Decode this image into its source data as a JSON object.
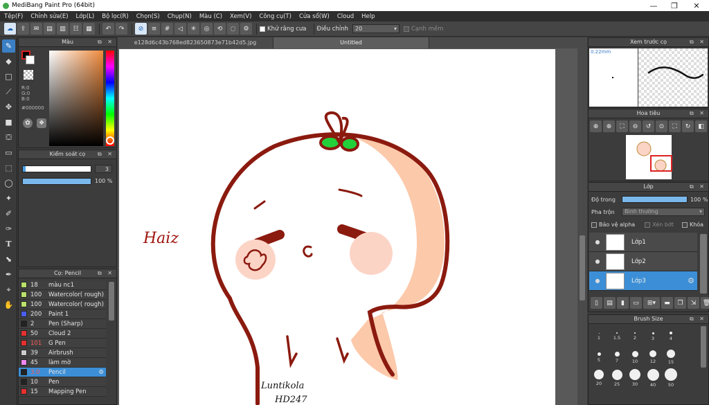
{
  "window": {
    "title": "MediBang Paint Pro (64bit)"
  },
  "menu": [
    "Tệp(F)",
    "Chỉnh sửa(E)",
    "Lớp(L)",
    "Bộ lọc(R)",
    "Chọn(S)",
    "Chụp(N)",
    "Màu (C)",
    "Xem(V)",
    "Công cụ(T)",
    "Cửa sổ(W)",
    "Cloud",
    "Help"
  ],
  "toolbar": {
    "antialias_label": "Khử răng cưa",
    "adjust_label": "Điều chỉnh",
    "adjust_value": "20",
    "snap_label": "Cạnh mềm"
  },
  "color_panel": {
    "title": "Màu",
    "r": "R:0",
    "g": "G:0",
    "b": "B:0",
    "hex": "#000000",
    "fg_color": "#000000",
    "bg_color": "#ffffff"
  },
  "brush_control": {
    "title": "Kiểm soát cọ",
    "size_value": "3",
    "opacity_value": "100 %"
  },
  "brush_list": {
    "title": "Cọ: Pencil",
    "items": [
      {
        "color": "#b9e26a",
        "size": "18",
        "name": "màu nc1"
      },
      {
        "color": "#b9e26a",
        "size": "100",
        "name": "Watercolor( rough)"
      },
      {
        "color": "#b9e26a",
        "size": "100",
        "name": "Watercolor( rough)"
      },
      {
        "color": "#4a5ef0",
        "size": "200",
        "name": "Paint 1"
      },
      {
        "color": "#222222",
        "size": "2",
        "name": "Pen (Sharp)"
      },
      {
        "color": "#e53030",
        "size": "50",
        "name": "Cloud 2"
      },
      {
        "color": "#e53030",
        "size": "101",
        "name": "G Pen"
      },
      {
        "color": "#cccccc",
        "size": "39",
        "name": "Airbrush"
      },
      {
        "color": "#ee88ee",
        "size": "45",
        "name": "làm mờ"
      },
      {
        "color": "#222222",
        "size": "3.0",
        "name": "Pencil"
      },
      {
        "color": "#222222",
        "size": "10",
        "name": "Pen"
      },
      {
        "color": "#e53030",
        "size": "15",
        "name": "Mapping Pen"
      }
    ]
  },
  "tabs": [
    "e128d6c43b768ed823650873e71b42d5.jpg",
    "Untitled"
  ],
  "artwork": {
    "text1": "Haiz",
    "signature1": "Luntikola",
    "signature2": "HD247"
  },
  "preview_panel": {
    "title": "Xem trước cọ",
    "size_label": "0.22mm"
  },
  "navigator_panel": {
    "title": "Hoa tiêu"
  },
  "layers_panel": {
    "title": "Lớp",
    "opacity_label": "Độ trong",
    "opacity_value": "100 %",
    "blend_label": "Pha trộn",
    "blend_value": "Bình thường",
    "protect_alpha": "Bảo vệ alpha",
    "clipping": "Xén bớt",
    "lock": "Khóa",
    "layers": [
      {
        "name": "Lớp1"
      },
      {
        "name": "Lớp2"
      },
      {
        "name": "Lớp3"
      }
    ]
  },
  "brush_size_panel": {
    "title": "Brush Size",
    "sizes": [
      "1",
      "1.5",
      "2",
      "3",
      "4",
      "",
      "5",
      "7",
      "10",
      "12",
      "15",
      "",
      "20",
      "25",
      "30",
      "40",
      "50",
      ""
    ]
  }
}
